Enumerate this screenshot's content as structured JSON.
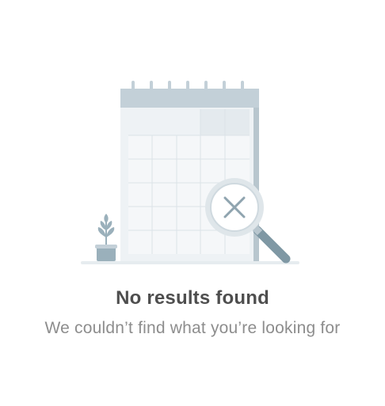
{
  "empty_state": {
    "title": "No results found",
    "subtitle": "We couldn’t find what you’re looking for",
    "illustration_icon": "calendar-search-no-results-icon"
  },
  "colors": {
    "title": "#4e4e4e",
    "subtitle": "#8d8d8d",
    "calendar_header": "#c3d0d8",
    "calendar_body": "#eef2f5",
    "grid_lines": "#dbe3e8",
    "magnifier": "#8fa4af",
    "plant": "#9ab0bb"
  }
}
